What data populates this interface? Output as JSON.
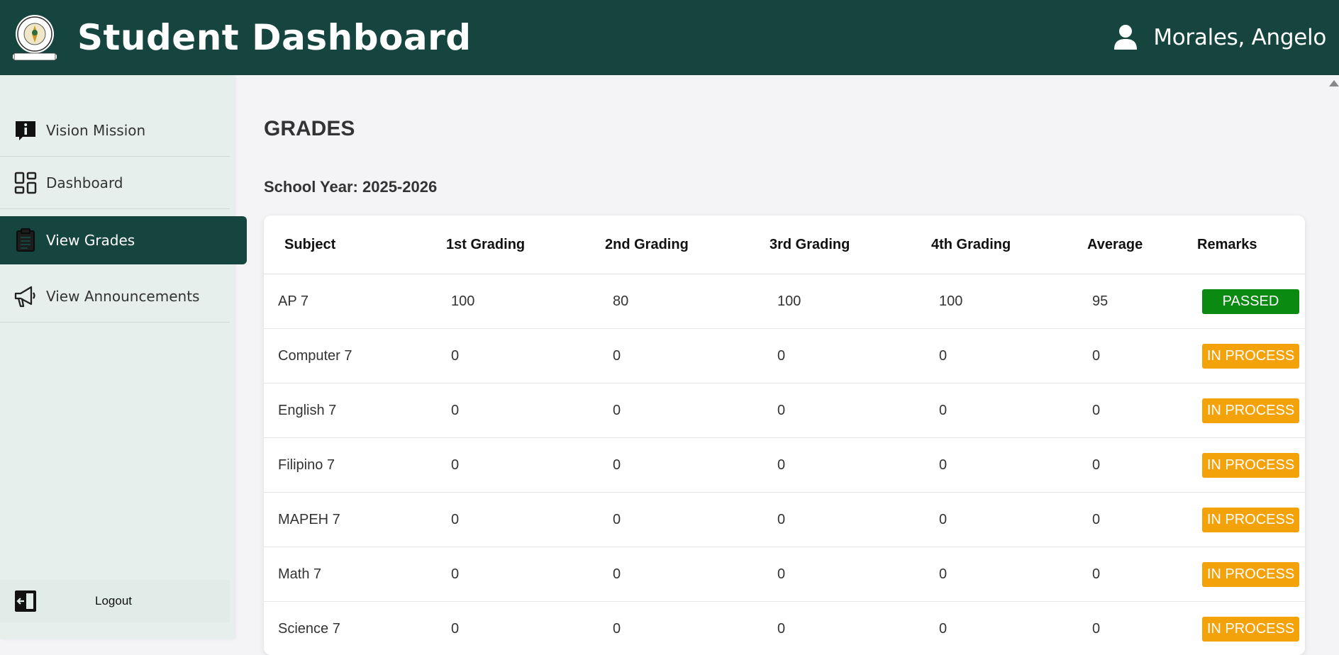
{
  "header": {
    "title": "Student Dashboard",
    "user_name": "Morales, Angelo"
  },
  "sidebar": {
    "items": [
      {
        "label": "Vision Mission",
        "icon": "info-icon"
      },
      {
        "label": "Dashboard",
        "icon": "dashboard-grid-icon"
      },
      {
        "label": "View Grades",
        "icon": "clipboard-icon",
        "active": true
      },
      {
        "label": "View Announcements",
        "icon": "megaphone-icon"
      }
    ],
    "logout_label": "Logout"
  },
  "main": {
    "title": "GRADES",
    "school_year": "School Year: 2025-2026"
  },
  "grades_table": {
    "columns": [
      "Subject",
      "1st Grading",
      "2nd Grading",
      "3rd Grading",
      "4th Grading",
      "Average",
      "Remarks"
    ],
    "rows": [
      {
        "subject": "AP 7",
        "q1": "100",
        "q2": "80",
        "q3": "100",
        "q4": "100",
        "average": "95",
        "remarks": "PASSED",
        "status": "passed"
      },
      {
        "subject": "Computer 7",
        "q1": "0",
        "q2": "0",
        "q3": "0",
        "q4": "0",
        "average": "0",
        "remarks": "IN PROCESS",
        "status": "process"
      },
      {
        "subject": "English 7",
        "q1": "0",
        "q2": "0",
        "q3": "0",
        "q4": "0",
        "average": "0",
        "remarks": "IN PROCESS",
        "status": "process"
      },
      {
        "subject": "Filipino 7",
        "q1": "0",
        "q2": "0",
        "q3": "0",
        "q4": "0",
        "average": "0",
        "remarks": "IN PROCESS",
        "status": "process"
      },
      {
        "subject": "MAPEH 7",
        "q1": "0",
        "q2": "0",
        "q3": "0",
        "q4": "0",
        "average": "0",
        "remarks": "IN PROCESS",
        "status": "process"
      },
      {
        "subject": "Math 7",
        "q1": "0",
        "q2": "0",
        "q3": "0",
        "q4": "0",
        "average": "0",
        "remarks": "IN PROCESS",
        "status": "process"
      },
      {
        "subject": "Science 7",
        "q1": "0",
        "q2": "0",
        "q3": "0",
        "q4": "0",
        "average": "0",
        "remarks": "IN PROCESS",
        "status": "process"
      }
    ]
  },
  "colors": {
    "header_bg": "#15453e",
    "sidebar_bg": "#e7efec",
    "passed": "#0b8a11",
    "in_process": "#f4a20a"
  }
}
